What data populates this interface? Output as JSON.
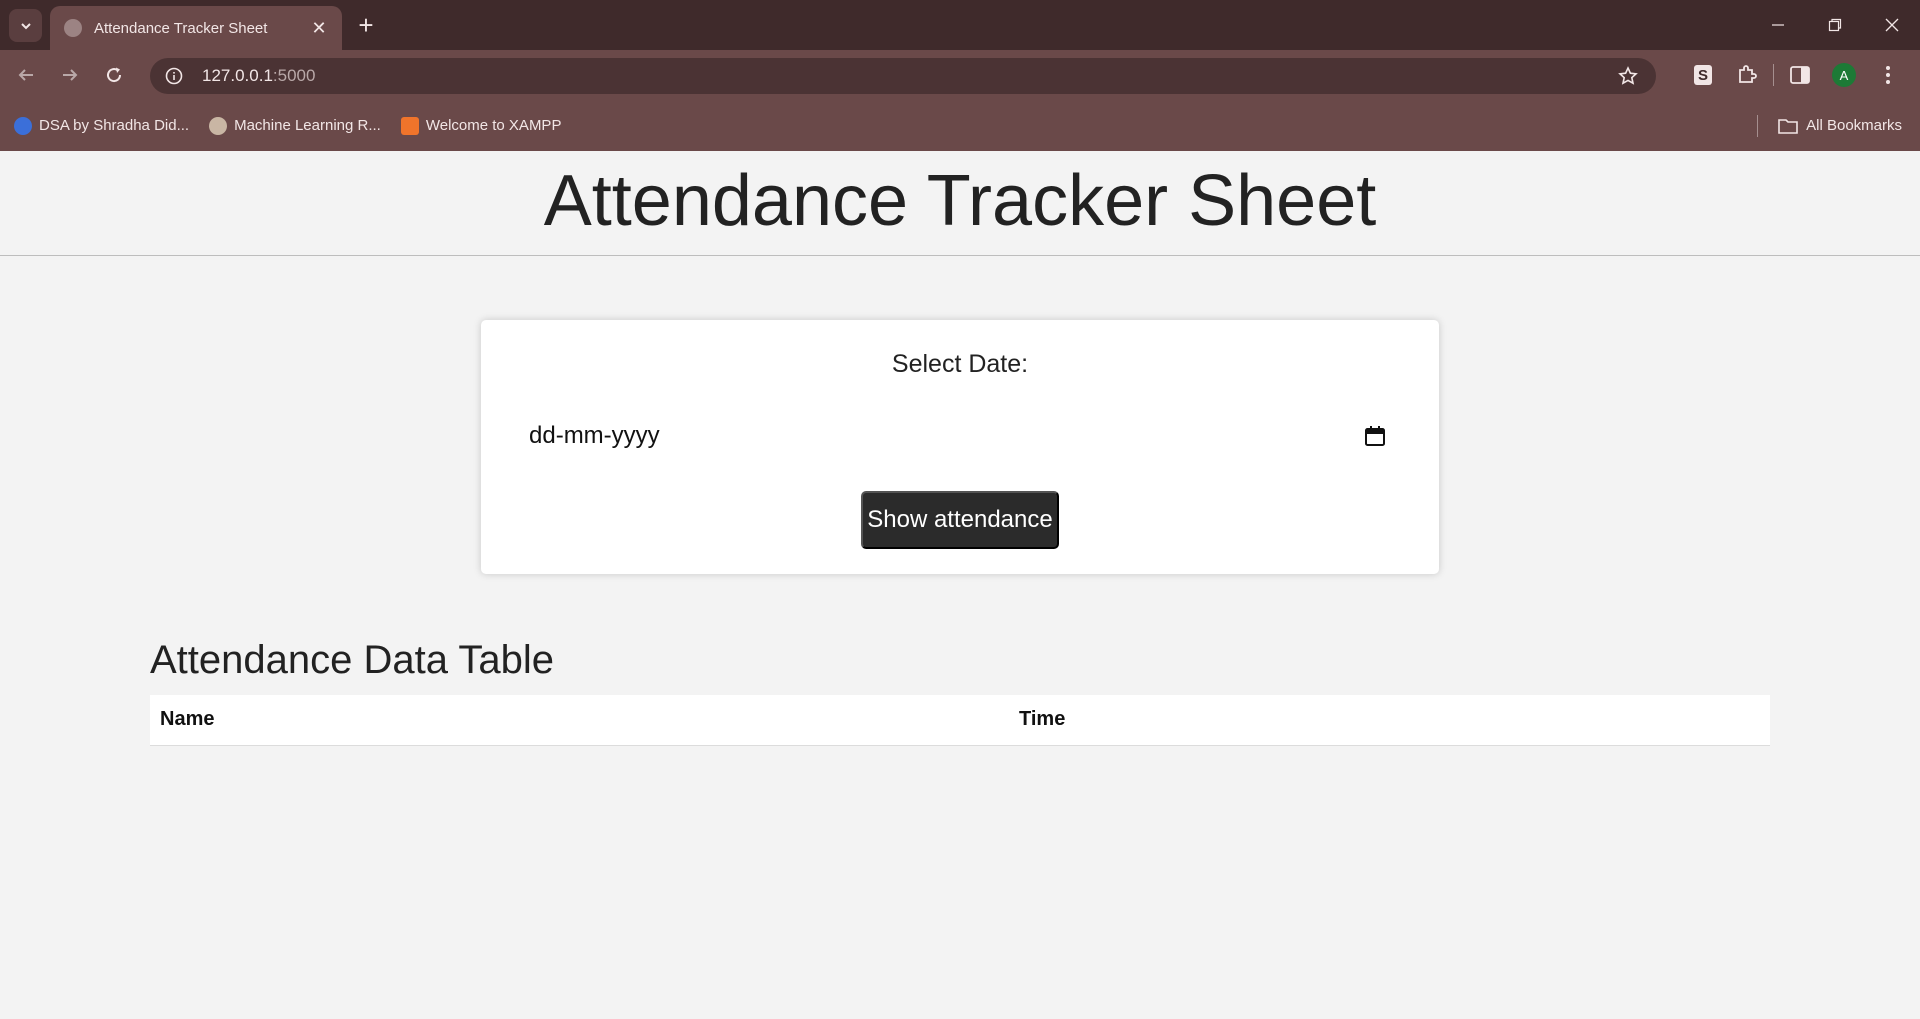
{
  "browser": {
    "tab_title": "Attendance Tracker Sheet",
    "url_host": "127.0.0.1",
    "url_port": ":5000",
    "profile_initial": "A",
    "bookmarks": [
      {
        "label": "DSA by Shradha Did...",
        "icon": "apna-college-icon",
        "color": "#3b6fd9"
      },
      {
        "label": "Machine Learning R...",
        "icon": "gear-favicon-icon",
        "color": "#c9b6a4"
      },
      {
        "label": "Welcome to XAMPP",
        "icon": "xampp-icon",
        "color": "#f0742b"
      }
    ],
    "all_bookmarks_label": "All Bookmarks"
  },
  "page": {
    "title": "Attendance Tracker Sheet",
    "form": {
      "label": "Select Date:",
      "date_placeholder": "dd-mm-yyyy",
      "submit_label": "Show attendance"
    },
    "table": {
      "heading": "Attendance Data Table",
      "columns": [
        "Name",
        "Time"
      ]
    }
  },
  "colors": {
    "chrome_dark": "#3f2a2b",
    "chrome_toolbar": "#6a4949",
    "button_bg": "#2b2b2b",
    "page_bg": "#f3f3f3"
  }
}
